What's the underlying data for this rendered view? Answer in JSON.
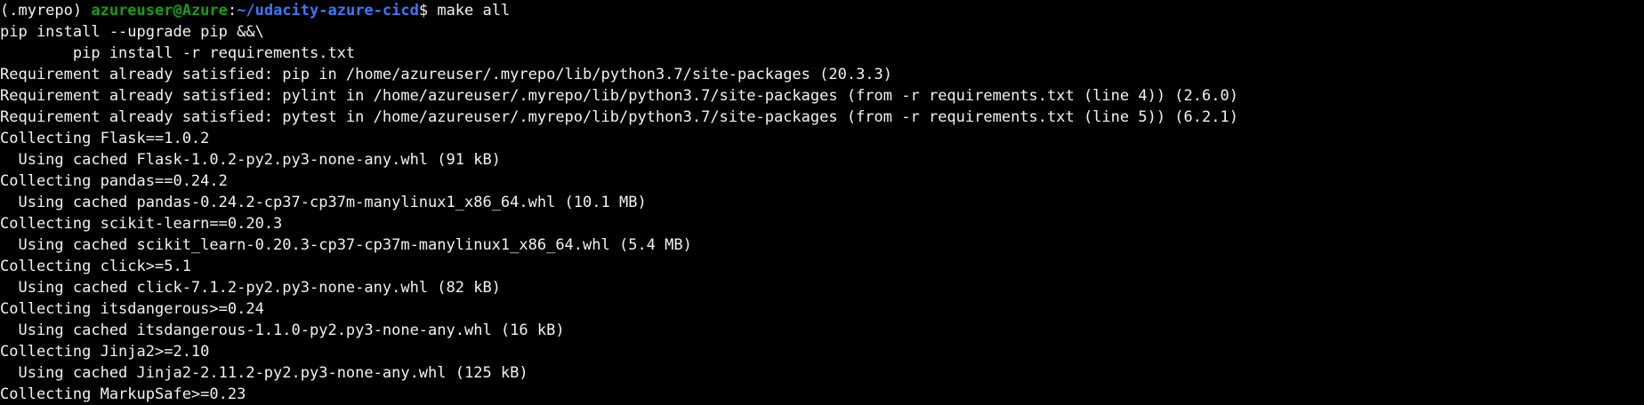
{
  "colors": {
    "background": "#000000",
    "text": "#f2f2f2",
    "prompt_user": "#13a10e",
    "prompt_path": "#3b78ff"
  },
  "prompt": {
    "venv": "(.myrepo) ",
    "user_host": "azureuser@Azure",
    "separator": ":",
    "path": "~/udacity-azure-cicd",
    "symbol": "$ ",
    "command": "make all"
  },
  "output_lines": [
    "pip install --upgrade pip &&\\",
    "        pip install -r requirements.txt",
    "Requirement already satisfied: pip in /home/azureuser/.myrepo/lib/python3.7/site-packages (20.3.3)",
    "Requirement already satisfied: pylint in /home/azureuser/.myrepo/lib/python3.7/site-packages (from -r requirements.txt (line 4)) (2.6.0)",
    "Requirement already satisfied: pytest in /home/azureuser/.myrepo/lib/python3.7/site-packages (from -r requirements.txt (line 5)) (6.2.1)",
    "Collecting Flask==1.0.2",
    "  Using cached Flask-1.0.2-py2.py3-none-any.whl (91 kB)",
    "Collecting pandas==0.24.2",
    "  Using cached pandas-0.24.2-cp37-cp37m-manylinux1_x86_64.whl (10.1 MB)",
    "Collecting scikit-learn==0.20.3",
    "  Using cached scikit_learn-0.20.3-cp37-cp37m-manylinux1_x86_64.whl (5.4 MB)",
    "Collecting click>=5.1",
    "  Using cached click-7.1.2-py2.py3-none-any.whl (82 kB)",
    "Collecting itsdangerous>=0.24",
    "  Using cached itsdangerous-1.1.0-py2.py3-none-any.whl (16 kB)",
    "Collecting Jinja2>=2.10",
    "  Using cached Jinja2-2.11.2-py2.py3-none-any.whl (125 kB)",
    "Collecting MarkupSafe>=0.23"
  ]
}
